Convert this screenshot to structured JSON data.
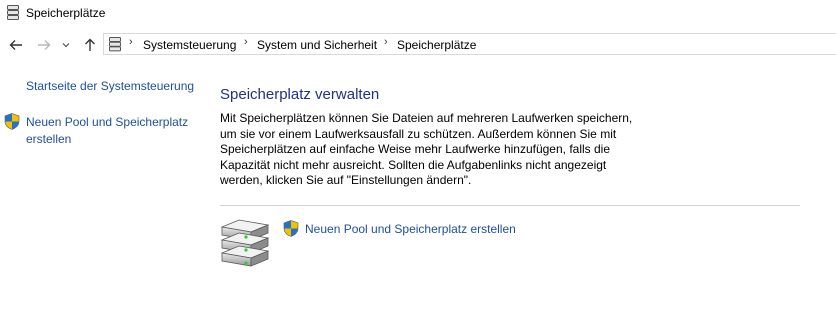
{
  "window": {
    "title": "Speicherplätze"
  },
  "nav": {
    "back_icon": "back-arrow-icon",
    "forward_icon": "forward-arrow-icon",
    "recent_icon": "chevron-down-icon",
    "up_icon": "up-arrow-icon"
  },
  "breadcrumb": {
    "items": [
      "Systemsteuerung",
      "System und Sicherheit",
      "Speicherplätze"
    ],
    "separator": "›"
  },
  "sidebar": {
    "home_link": "Startseite der Systemsteuerung",
    "create_link_line1": "Neuen Pool und Speicherplatz",
    "create_link_line2": "erstellen"
  },
  "main": {
    "heading": "Speicherplatz verwalten",
    "description_lines": [
      "Mit Speicherplätzen können Sie Dateien auf mehreren Laufwerken speichern,",
      "um sie vor einem Laufwerksausfall zu schützen. Außerdem können Sie mit",
      "Speicherplätzen auf einfache Weise mehr Laufwerke hinzufügen, falls die",
      "Kapazität nicht mehr ausreicht. Sollten die Aufgabenlinks nicht angezeigt",
      "werden, klicken Sie auf \"Einstellungen ändern\"."
    ],
    "action_link": "Neuen Pool und Speicherplatz erstellen"
  },
  "colors": {
    "link": "#1e4e9e",
    "heading": "#1e3287",
    "shield_blue": "#2a6fc9",
    "shield_yellow": "#f2c200"
  }
}
